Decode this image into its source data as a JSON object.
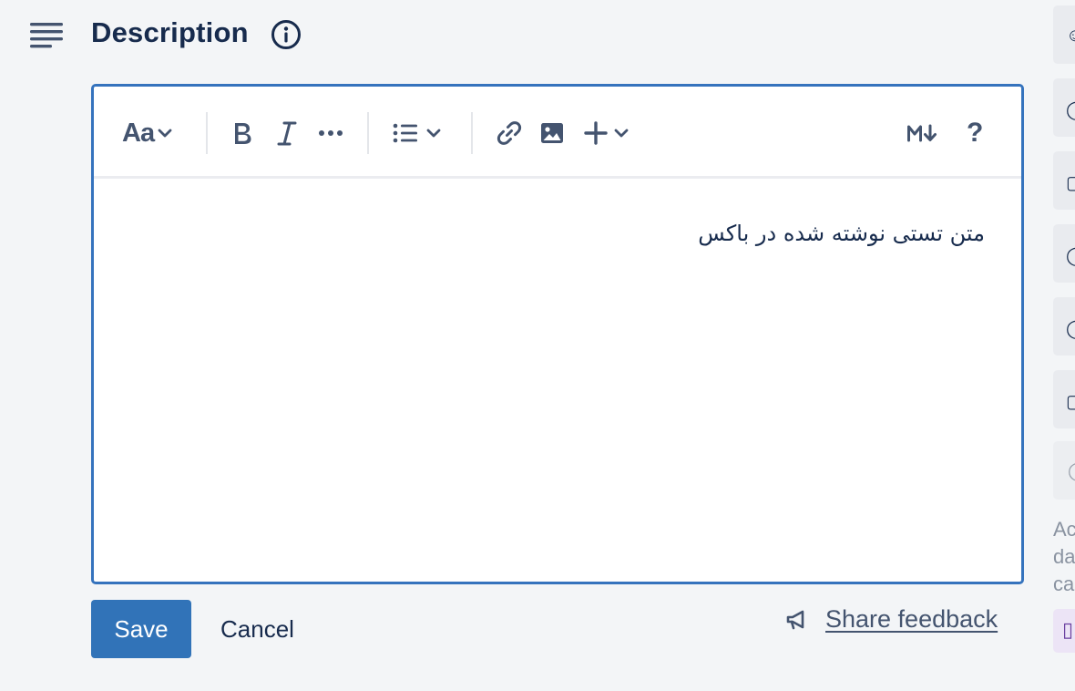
{
  "header": {
    "title": "Description",
    "icon": "description-lines-icon",
    "info_icon": "info-circle-icon"
  },
  "toolbar": {
    "text_style_label": "Aa",
    "items": [
      "text-style-dropdown",
      "bold-icon",
      "italic-icon",
      "more-formatting-icon",
      "bullet-list-dropdown",
      "link-icon",
      "image-icon",
      "insert-dropdown",
      "markdown-icon",
      "help-icon"
    ],
    "help_label": "?"
  },
  "editor": {
    "content": "متن تستی نوشته شده در باکس",
    "direction": "rtl"
  },
  "actions": {
    "save_label": "Save",
    "cancel_label": "Cancel",
    "feedback_label": "Share feedback",
    "feedback_icon": "megaphone-icon"
  },
  "sidebar": {
    "text_lines": [
      "Ac",
      "da",
      "ca"
    ]
  },
  "colors": {
    "accent": "#3573bd",
    "save_button": "#3173b8",
    "text": "#172b4d",
    "muted_link": "#44546f",
    "background": "#f3f5f7"
  }
}
